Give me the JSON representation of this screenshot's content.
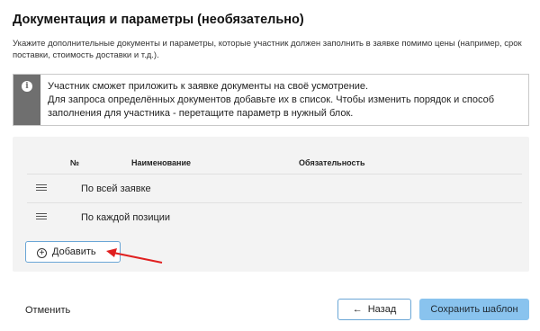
{
  "page": {
    "title": "Документация и параметры (необязательно)",
    "description": "Укажите дополнительные документы и параметры, которые участник должен заполнить в заявке помимо цены (например, срок поставки, стоимость доставки и т.д.)."
  },
  "info": {
    "line1": "Участник сможет приложить к заявке документы на своё усмотрение.",
    "line2": "Для запроса определённых документов добавьте их в список. Чтобы изменить порядок и способ",
    "line3": "заполнения для участника - перетащите параметр в нужный блок."
  },
  "table": {
    "headers": {
      "number": "№",
      "name": "Наименование",
      "required": "Обязательность"
    },
    "rows": [
      {
        "name": "По всей заявке"
      },
      {
        "name": "По каждой позиции"
      }
    ]
  },
  "buttons": {
    "add": "Добавить",
    "cancel": "Отменить",
    "back": "Назад",
    "save": "Сохранить шаблон"
  },
  "colors": {
    "accent_border": "#6aa6d6",
    "primary_button": "#89c3ee",
    "info_stripe": "#6f6f6f",
    "annotation_arrow": "#e02020"
  },
  "icons": [
    "info-icon",
    "drag-handle-icon",
    "plus-circle-icon",
    "arrow-left-icon"
  ]
}
